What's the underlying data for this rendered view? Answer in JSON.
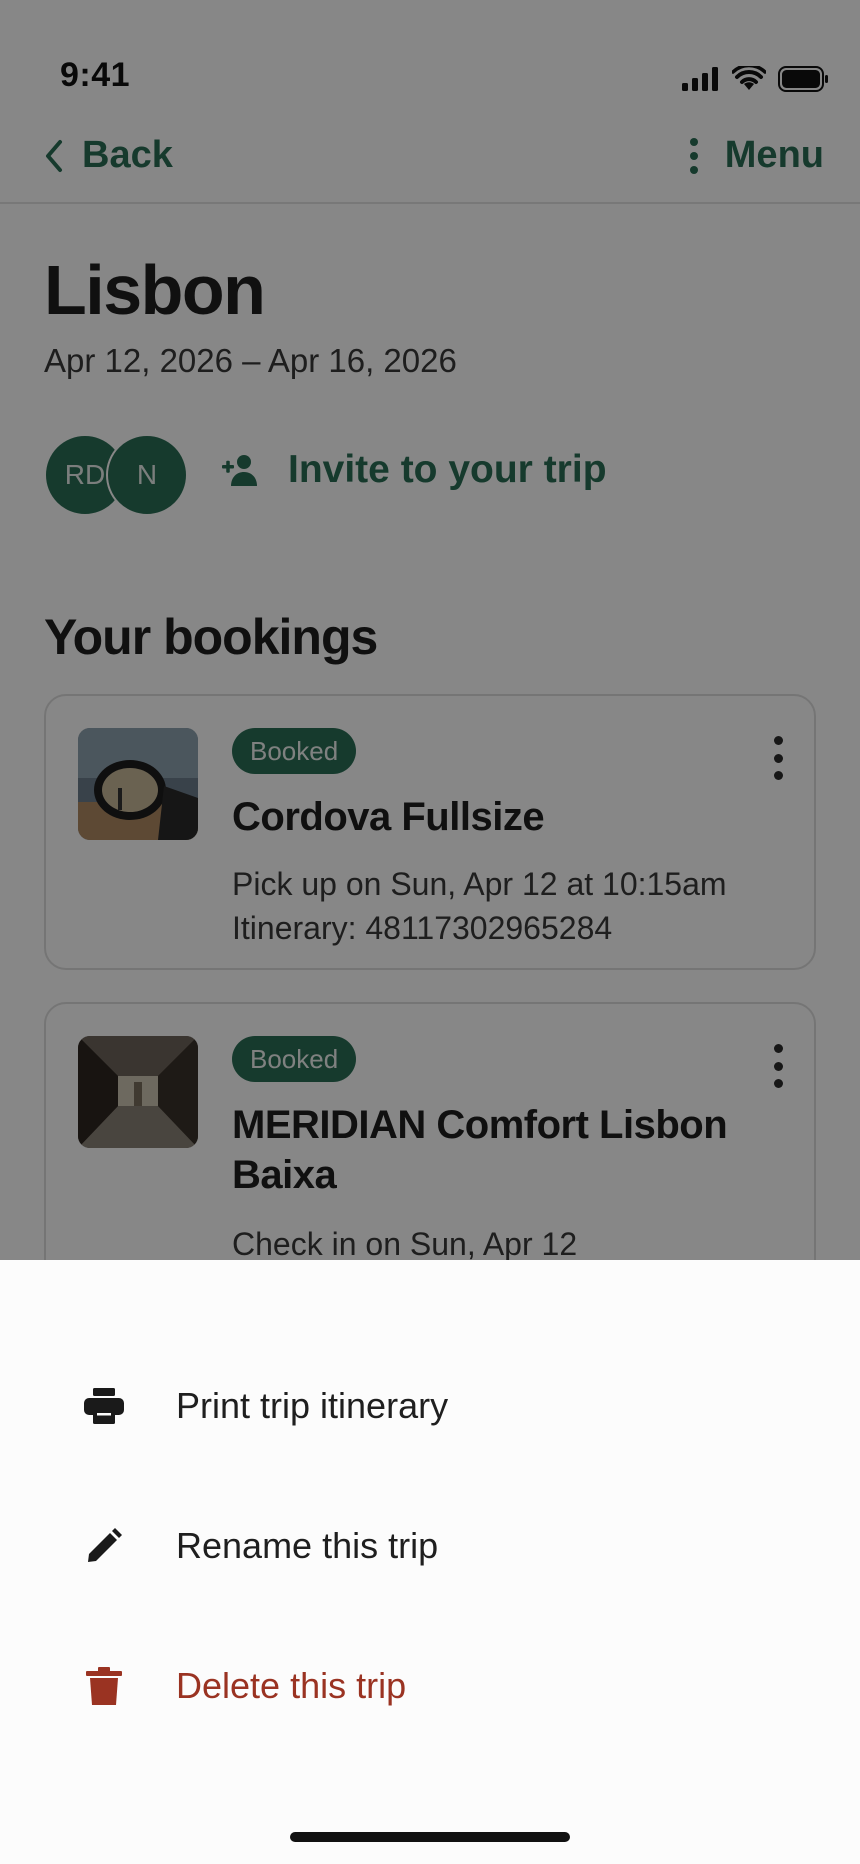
{
  "status": {
    "time": "9:41"
  },
  "nav": {
    "back_label": "Back",
    "menu_label": "Menu"
  },
  "trip": {
    "title": "Lisbon",
    "dates": "Apr 12, 2026 – Apr 16, 2026",
    "travelers": [
      "RD",
      "N"
    ],
    "invite_label": "Invite to your trip"
  },
  "bookings": {
    "section_title": "Your bookings",
    "items": [
      {
        "status": "Booked",
        "title": "Cordova Fullsize",
        "line1": "Pick up on Sun, Apr 12 at 10:15am",
        "line2": "Itinerary: 48117302965284",
        "image": "car-side-mirror-photo"
      },
      {
        "status": "Booked",
        "title": "MERIDIAN Comfort Lisbon Baixa",
        "line1": "Check in on Sun, Apr 12",
        "image": "hotel-hallway-photo"
      }
    ]
  },
  "menu_sheet": {
    "items": [
      {
        "label": "Print trip itinerary",
        "icon": "printer-icon"
      },
      {
        "label": "Rename this trip",
        "icon": "pencil-icon"
      },
      {
        "label": "Delete this trip",
        "icon": "trash-icon"
      }
    ]
  },
  "colors": {
    "brand_green": "#2b6e55",
    "danger_red": "#9a3322",
    "scrim": "rgba(0,0,0,0.47)"
  }
}
